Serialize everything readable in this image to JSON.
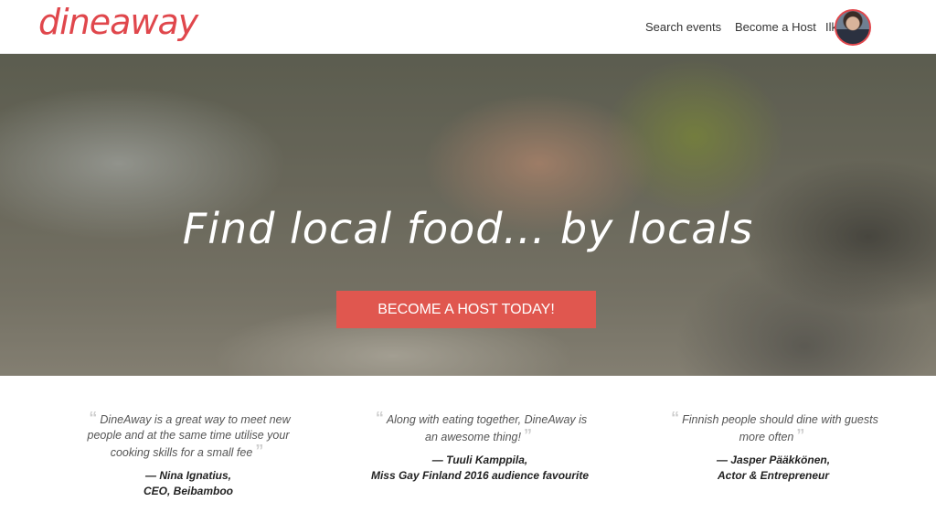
{
  "header": {
    "logo_text": "dineaway",
    "nav": {
      "search": "Search events",
      "become_host": "Become a Host",
      "user": "Ilkka"
    }
  },
  "hero": {
    "title": "Find local food... by locals",
    "cta_label": "BECOME A HOST TODAY!"
  },
  "testimonials": [
    {
      "quote": "DineAway is a great way to meet new people and at the same time utilise your cooking skills for a small fee",
      "author_line1": "— Nina Ignatius,",
      "author_line2": "CEO, Beibamboo"
    },
    {
      "quote": "Along with eating together, DineAway is an awesome thing!",
      "author_line1": "— Tuuli Kamppila,",
      "author_line2": "Miss Gay Finland 2016 audience favourite"
    },
    {
      "quote": "Finnish people should dine with guests more often",
      "author_line1": "— Jasper Pääkkönen,",
      "author_line2": "Actor & Entrepreneur"
    }
  ],
  "colors": {
    "brand": "#e0474c",
    "cta": "#e0574f"
  },
  "icons": {
    "quote_open": "“",
    "quote_close": "”"
  }
}
